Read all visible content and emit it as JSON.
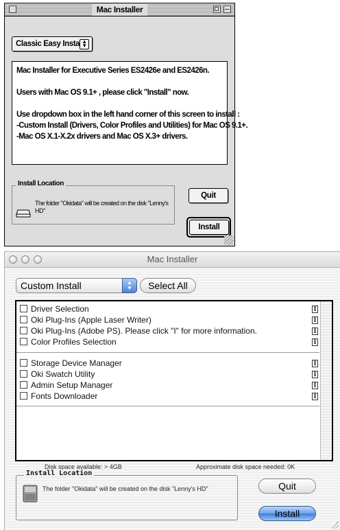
{
  "classic": {
    "title": "Mac Installer",
    "popup_value": "Classic Easy Install",
    "lines": [
      "Mac Installer for  Executive Series ES2426e and ES2426n.",
      "Users with Mac OS 9.1+ , please click \"Install\" now.",
      "Use dropdown box in the left hand corner of this screen to install :",
      "-Custom Install (Drivers, Color Profiles and Utilities) for Mac OS 9.1+.",
      "-Mac OS X.1-X.2x drivers and Mac OS X.3+ drivers."
    ],
    "location_label": "Install Location",
    "location_text": "The folder \"Okidata\" will be created on the disk \"Lenny's HD\"",
    "quit_label": "Quit",
    "install_label": "Install"
  },
  "aqua": {
    "title": "Mac Installer",
    "popup_value": "Custom Install",
    "select_all_label": "Select All",
    "info_glyph": "I",
    "groups": [
      [
        "Driver Selection",
        "Oki Plug-Ins (Apple Laser Writer)",
        "Oki Plug-Ins (Adobe PS). Please click \"I\" for more information.",
        "Color Profiles Selection"
      ],
      [
        "Storage Device Manager",
        "Oki Swatch Utility",
        "Admin Setup Manager",
        "Fonts Downloader"
      ]
    ],
    "disk_space": "Disk space available: > 4GB",
    "space_needed": "Approximate disk space needed: 0K",
    "location_label": "Install Location",
    "location_text": "The folder \"Okidata\" will be created on the disk \"Lenny's HD\"",
    "quit_label": "Quit",
    "install_label": "Install"
  }
}
